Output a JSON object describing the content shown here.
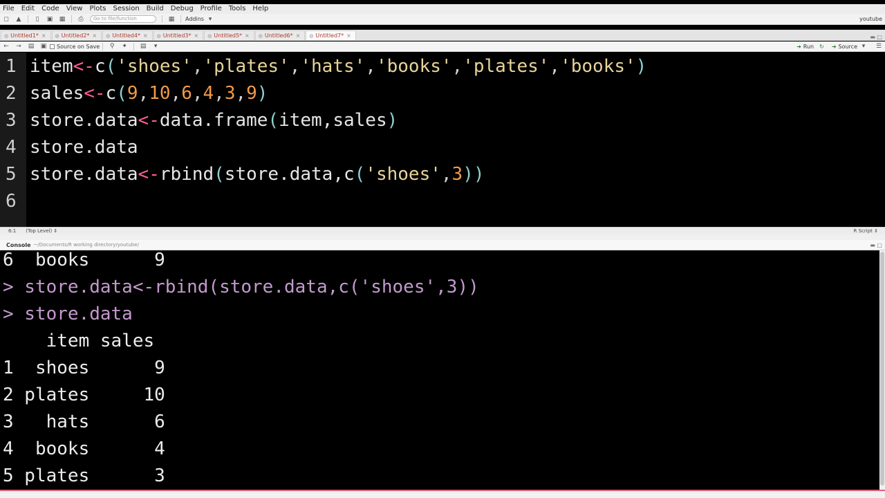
{
  "menubar": {
    "items": [
      "File",
      "Edit",
      "Code",
      "View",
      "Plots",
      "Session",
      "Build",
      "Debug",
      "Profile",
      "Tools",
      "Help"
    ]
  },
  "toolbar": {
    "goto_placeholder": "Go to file/function",
    "addins_label": "Addins",
    "user_label": "youtube"
  },
  "tabs": [
    {
      "label": "Untitled1*",
      "active": false
    },
    {
      "label": "Untitled2*",
      "active": false
    },
    {
      "label": "Untitled4*",
      "active": false
    },
    {
      "label": "Untitled3*",
      "active": false
    },
    {
      "label": "Untitled5*",
      "active": false
    },
    {
      "label": "Untitled6*",
      "active": false
    },
    {
      "label": "Untitled7*",
      "active": true
    }
  ],
  "editor_toolbar": {
    "source_on_save": "Source on Save",
    "run_label": "Run",
    "source_label": "Source"
  },
  "editor": {
    "lines": [
      {
        "num": "1",
        "tokens": [
          [
            "id",
            "item"
          ],
          [
            "op",
            "<-"
          ],
          [
            "id",
            "c"
          ],
          [
            "paren",
            "("
          ],
          [
            "str",
            "'shoes'"
          ],
          [
            "punct",
            ","
          ],
          [
            "str",
            "'plates'"
          ],
          [
            "punct",
            ","
          ],
          [
            "str",
            "'hats'"
          ],
          [
            "punct",
            ","
          ],
          [
            "str",
            "'books'"
          ],
          [
            "punct",
            ","
          ],
          [
            "str",
            "'plates'"
          ],
          [
            "punct",
            ","
          ],
          [
            "str",
            "'books'"
          ],
          [
            "paren",
            ")"
          ]
        ]
      },
      {
        "num": "2",
        "tokens": [
          [
            "id",
            "sales"
          ],
          [
            "op",
            "<-"
          ],
          [
            "id",
            "c"
          ],
          [
            "paren",
            "("
          ],
          [
            "num",
            "9"
          ],
          [
            "punct",
            ","
          ],
          [
            "num",
            "10"
          ],
          [
            "punct",
            ","
          ],
          [
            "num",
            "6"
          ],
          [
            "punct",
            ","
          ],
          [
            "num",
            "4"
          ],
          [
            "punct",
            ","
          ],
          [
            "num",
            "3"
          ],
          [
            "punct",
            ","
          ],
          [
            "num",
            "9"
          ],
          [
            "paren",
            ")"
          ]
        ]
      },
      {
        "num": "3",
        "tokens": [
          [
            "id",
            "store.data"
          ],
          [
            "op",
            "<-"
          ],
          [
            "id",
            "data.frame"
          ],
          [
            "paren",
            "("
          ],
          [
            "id",
            "item,sales"
          ],
          [
            "paren",
            ")"
          ]
        ]
      },
      {
        "num": "4",
        "tokens": [
          [
            "id",
            "store.data"
          ]
        ]
      },
      {
        "num": "5",
        "tokens": [
          [
            "id",
            "store.data"
          ],
          [
            "op",
            "<-"
          ],
          [
            "id",
            "rbind"
          ],
          [
            "paren",
            "("
          ],
          [
            "id",
            "store.data,c"
          ],
          [
            "paren",
            "("
          ],
          [
            "str",
            "'shoes'"
          ],
          [
            "punct",
            ","
          ],
          [
            "num",
            "3"
          ],
          [
            "paren",
            "))"
          ]
        ]
      },
      {
        "num": "6",
        "tokens": []
      }
    ]
  },
  "statusbar": {
    "position": "6:1",
    "scope": "(Top Level) ⇕",
    "file_type": "R Script ⇕"
  },
  "console_header": {
    "title": "Console",
    "path": "~/Documents/R working directory/youtube/"
  },
  "console": {
    "lines": [
      {
        "kind": "out",
        "text": "6  books      9"
      },
      {
        "kind": "cmd",
        "text": "> store.data<-rbind(store.data,c('shoes',3))"
      },
      {
        "kind": "cmd",
        "text": "> store.data"
      },
      {
        "kind": "out",
        "text": "    item sales"
      },
      {
        "kind": "out",
        "text": "1  shoes      9"
      },
      {
        "kind": "out",
        "text": "2 plates     10"
      },
      {
        "kind": "out",
        "text": "3   hats      6"
      },
      {
        "kind": "out",
        "text": "4  books      4"
      },
      {
        "kind": "out",
        "text": "5 plates      3"
      }
    ]
  },
  "colors": {
    "operator": "#ff5c9a",
    "string": "#e8d49a",
    "number": "#f29a4a",
    "console_command": "#c39acd"
  }
}
